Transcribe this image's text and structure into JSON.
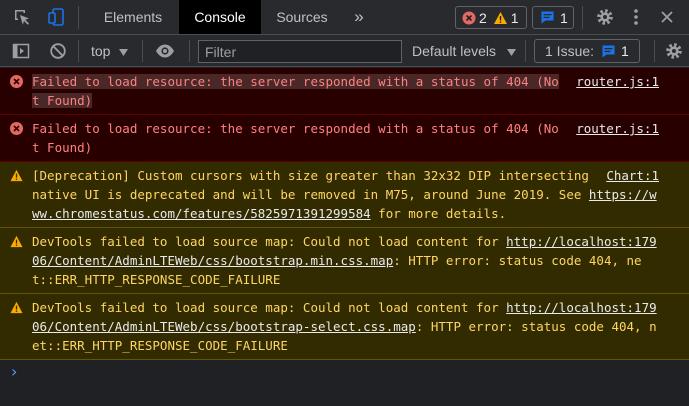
{
  "tabs": {
    "elements": "Elements",
    "console": "Console",
    "sources": "Sources",
    "more": "»"
  },
  "counters": {
    "errors": "2",
    "warnings": "1",
    "messages": "1"
  },
  "toolbar": {
    "context": "top",
    "filter_placeholder": "Filter",
    "levels": "Default levels",
    "issues_label": "1 Issue:",
    "issues_count": "1"
  },
  "colors": {
    "error_icon": "#e46962",
    "warning_icon": "#f9ab00",
    "info_badge": "#1a73e8",
    "active_tab_bg": "#000000"
  },
  "messages": [
    {
      "level": "error",
      "text": "Failed to load resource: the server responded with a status of 404 (Not Found)",
      "source": "router.js:1"
    },
    {
      "level": "error",
      "text": "Failed to load resource: the server responded with a status of 404 (Not Found)",
      "source": "router.js:1"
    },
    {
      "level": "warning",
      "text_before": "[Deprecation] Custom cursors with size greater than 32x32 DIP intersecting native UI is deprecated and will be removed in M75, around June 2019. See ",
      "link": "https://www.chromestatus.com/features/5825971391299584",
      "text_after": " for more details.",
      "source": "Chart:1"
    },
    {
      "level": "warning",
      "text_before": "DevTools failed to load source map: Could not load content for ",
      "link": "http://localhost:17906/Content/AdminLTEWeb/css/bootstrap.min.css.map",
      "text_after": ": HTTP error: status code 404, net::ERR_HTTP_RESPONSE_CODE_FAILURE"
    },
    {
      "level": "warning",
      "text_before": "DevTools failed to load source map: Could not load content for ",
      "link": "http://localhost:17906/Content/AdminLTEWeb/css/bootstrap-select.css.map",
      "text_after": ": HTTP error: status code 404, net::ERR_HTTP_RESPONSE_CODE_FAILURE"
    }
  ],
  "prompt_symbol": "›"
}
